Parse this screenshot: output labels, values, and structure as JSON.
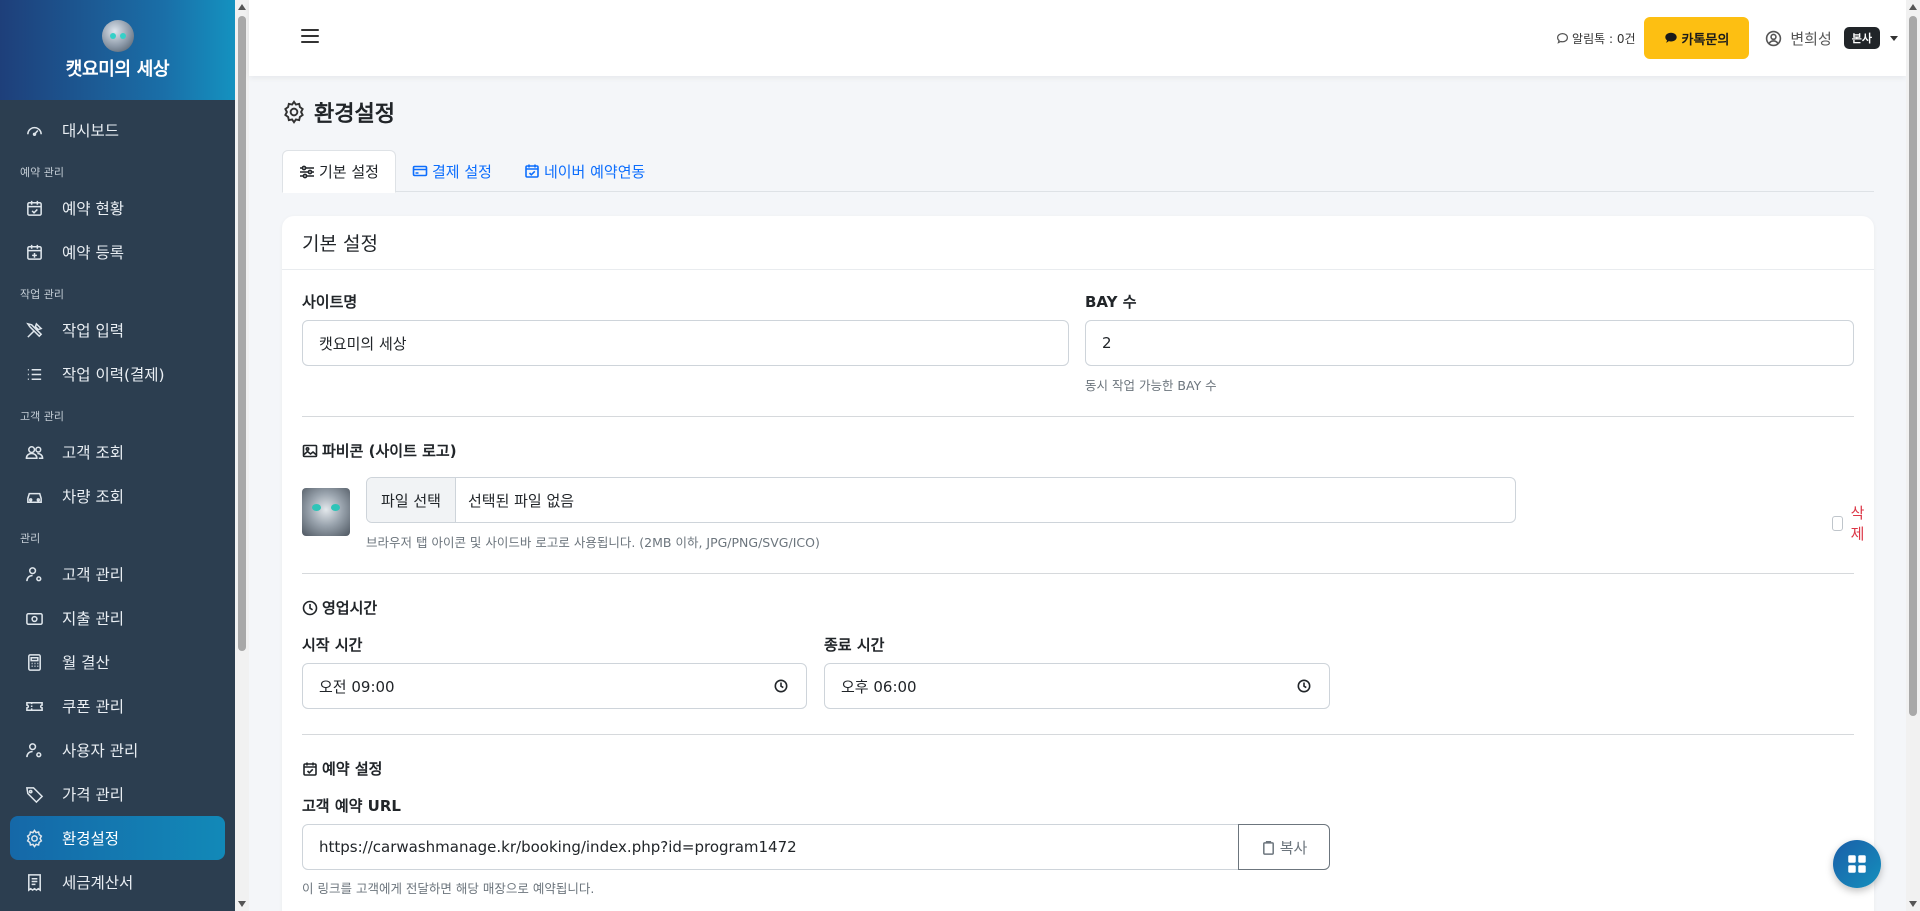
{
  "brand": {
    "name": "캣요미의 세상"
  },
  "sidebar": {
    "items": [
      {
        "label": "대시보드",
        "icon": "speedometer-icon"
      },
      {
        "group": "예약 관리"
      },
      {
        "label": "예약 현황",
        "icon": "calendar-check-icon"
      },
      {
        "label": "예약 등록",
        "icon": "calendar-plus-icon"
      },
      {
        "group": "작업 관리"
      },
      {
        "label": "작업 입력",
        "icon": "tools-icon"
      },
      {
        "label": "작업 이력(결제)",
        "icon": "list-icon"
      },
      {
        "group": "고객 관리"
      },
      {
        "label": "고객 조회",
        "icon": "people-icon"
      },
      {
        "label": "차량 조회",
        "icon": "car-icon"
      },
      {
        "group": "관리"
      },
      {
        "label": "고객 관리",
        "icon": "person-gear-icon"
      },
      {
        "label": "지출 관리",
        "icon": "cash-icon"
      },
      {
        "label": "월 결산",
        "icon": "calculator-icon"
      },
      {
        "label": "쿠폰 관리",
        "icon": "ticket-icon"
      },
      {
        "label": "사용자 관리",
        "icon": "person-gear-icon"
      },
      {
        "label": "가격 관리",
        "icon": "tag-icon"
      },
      {
        "label": "환경설정",
        "icon": "gear-icon",
        "active": true
      },
      {
        "label": "세금계산서",
        "icon": "receipt-icon"
      }
    ]
  },
  "topbar": {
    "alarm_label": "알림톡 : 0건",
    "kakao_button": "카톡문의",
    "user_name": "변희성",
    "user_badge": "본사"
  },
  "page": {
    "title": "환경설정",
    "tabs": [
      {
        "label": "기본 설정",
        "active": true,
        "icon": "sliders-icon"
      },
      {
        "label": "결제 설정",
        "active": false,
        "icon": "credit-card-icon"
      },
      {
        "label": "네이버 예약연동",
        "active": false,
        "icon": "calendar-check-icon"
      }
    ]
  },
  "form": {
    "card_title": "기본 설정",
    "site_name_label": "사이트명",
    "site_name_value": "캣요미의 세상",
    "bay_label": "BAY 수",
    "bay_value": "2",
    "bay_help": "동시 작업 가능한 BAY 수",
    "favicon_title": "파비콘 (사이트 로고)",
    "file_button": "파일 선택",
    "file_name": "선택된 파일 없음",
    "delete_label": "삭제",
    "favicon_help": "브라우저 탭 아이콘 및 사이드바 로고로 사용됩니다. (2MB 이하, JPG/PNG/SVG/ICO)",
    "hours_title": "영업시간",
    "start_label": "시작 시간",
    "start_value": "오전 09:00",
    "end_label": "종료 시간",
    "end_value": "오후 06:00",
    "reservation_title": "예약 설정",
    "url_label": "고객 예약 URL",
    "url_value": "https://carwashmanage.kr/booking/index.php?id=program1472",
    "copy_button": "복사",
    "url_help": "이 링크를 고객에게 전달하면 해당 매장으로 예약됩니다."
  },
  "colors": {
    "sidebar_bg": "#2c3e50",
    "accent": "#1289b8",
    "kakao": "#fdbf12",
    "danger": "#dc3545",
    "link": "#0d6efd"
  }
}
